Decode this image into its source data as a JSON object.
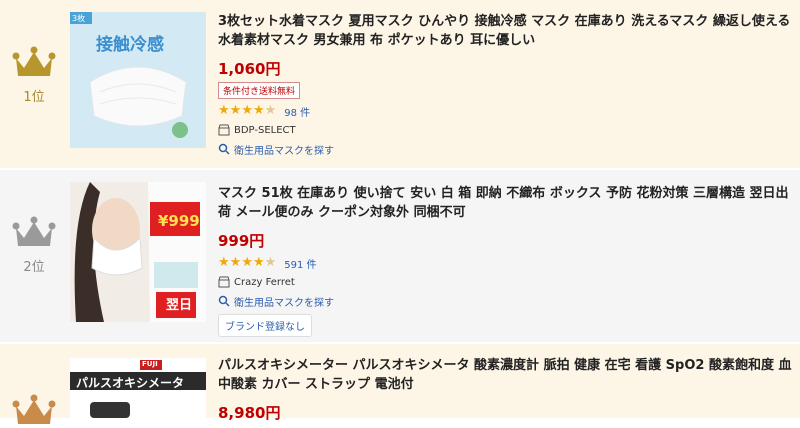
{
  "products": [
    {
      "rank": "1位",
      "thumb_text": "接触冷感",
      "thumb_tag": "3枚",
      "title": "3枚セット水着マスク 夏用マスク ひんやり 接触冷感 マスク 在庫あり 洗えるマスク 繰返し使える 水着素材マスク 男女兼用 布 ポケットあり 耳に優しい",
      "price": "1,060円",
      "badge": "条件付き送料無料",
      "review_count": "98 件",
      "shop": "BDP-SELECT",
      "search_link": "衛生用品マスクを探す"
    },
    {
      "rank": "2位",
      "thumb_price": "¥999",
      "thumb_next": "翌日",
      "title": "マスク 51枚 在庫あり 使い捨て 安い 白 箱 即納 不織布 ボックス 予防 花粉対策 三層構造 翌日出荷 メール便のみ クーポン対象外 同梱不可",
      "price": "999円",
      "review_count": "591 件",
      "shop": "Crazy Ferret",
      "search_link": "衛生用品マスクを探す",
      "brand_chip": "ブランド登録なし"
    },
    {
      "thumb_brand": "FUJI",
      "thumb_text": "パルスオキシメータ",
      "title": "パルスオキシメーター パルスオキシメータ 酸素濃度計 脈拍 健康 在宅 看護 SpO2 酸素飽和度 血中酸素 カバー ストラップ 電池付",
      "price": "8,980円"
    }
  ],
  "colors": {
    "gold": "#b8962e",
    "silver": "#9a9a9a",
    "price": "#bf0000",
    "link": "#2a5db0",
    "star": "#f2a900"
  },
  "icons": [
    "crown-icon",
    "shop-icon",
    "search-icon",
    "star-icon"
  ]
}
